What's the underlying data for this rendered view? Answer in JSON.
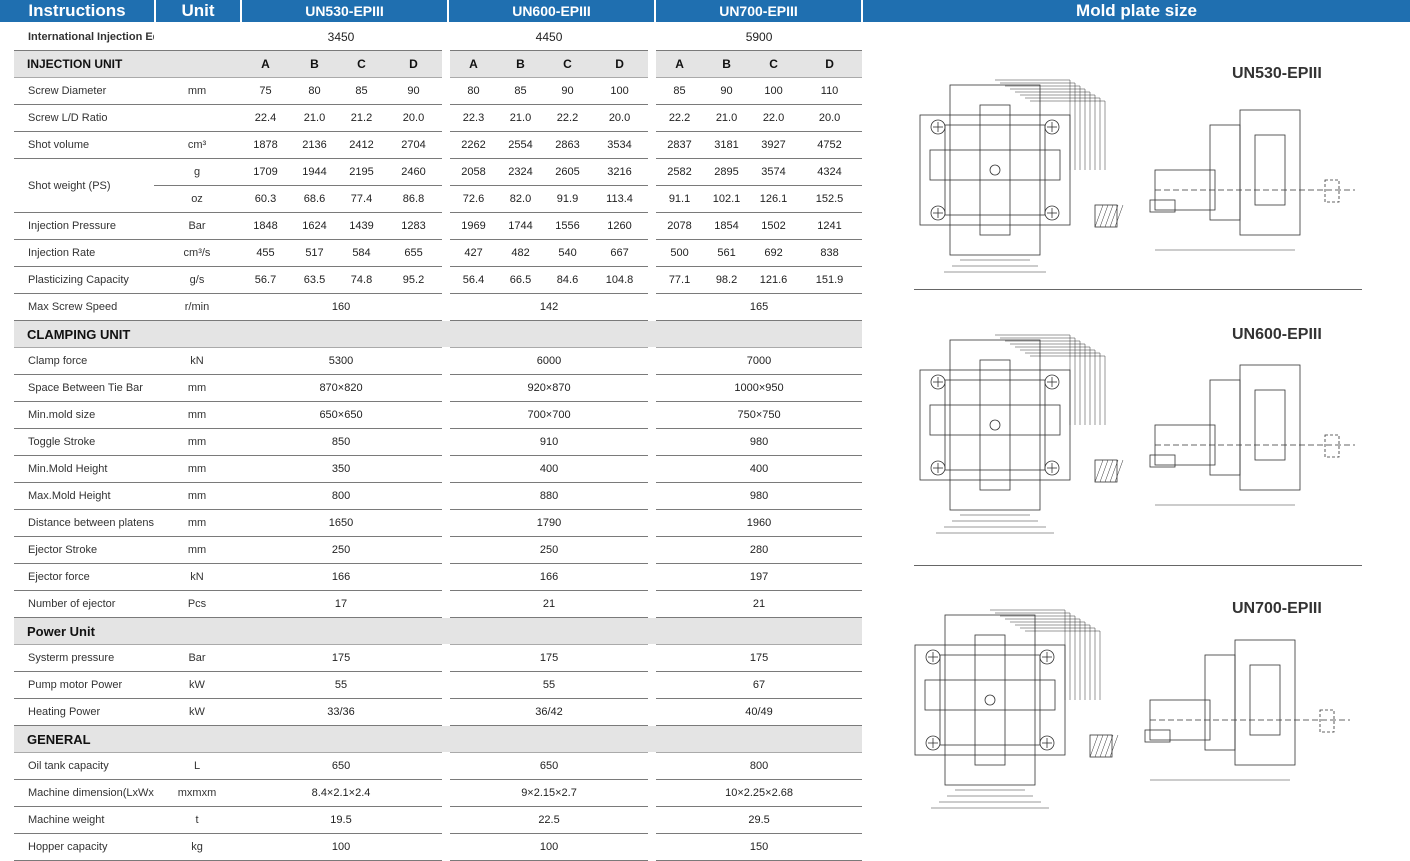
{
  "header": {
    "instructions": "Instructions",
    "unit": "Unit",
    "models": [
      "UN530-EPIII",
      "UN600-EPIII",
      "UN700-EPIII"
    ],
    "mold_plate": "Mold plate size"
  },
  "intl": {
    "label": "International Injection Equivalent",
    "values": [
      "3450",
      "4450",
      "5900"
    ]
  },
  "injection": {
    "title": "INJECTION UNIT",
    "letters": [
      "A",
      "B",
      "C",
      "D"
    ],
    "rows": [
      {
        "label": "Screw Diameter",
        "unit": "mm",
        "values": [
          "75",
          "80",
          "85",
          "90",
          "80",
          "85",
          "90",
          "100",
          "85",
          "90",
          "100",
          "110"
        ]
      },
      {
        "label": "Screw L/D Ratio",
        "unit": "",
        "values": [
          "22.4",
          "21.0",
          "21.2",
          "20.0",
          "22.3",
          "21.0",
          "22.2",
          "20.0",
          "22.2",
          "21.0",
          "22.0",
          "20.0"
        ]
      },
      {
        "label": "Shot volume",
        "unit": "cm³",
        "values": [
          "1878",
          "2136",
          "2412",
          "2704",
          "2262",
          "2554",
          "2863",
          "3534",
          "2837",
          "3181",
          "3927",
          "4752"
        ]
      },
      {
        "label": "Shot weight (PS)",
        "unit": "g",
        "values": [
          "1709",
          "1944",
          "2195",
          "2460",
          "2058",
          "2324",
          "2605",
          "3216",
          "2582",
          "2895",
          "3574",
          "4324"
        ]
      },
      {
        "label": "",
        "unit": "oz",
        "values": [
          "60.3",
          "68.6",
          "77.4",
          "86.8",
          "72.6",
          "82.0",
          "91.9",
          "113.4",
          "91.1",
          "102.1",
          "126.1",
          "152.5"
        ]
      },
      {
        "label": "Injection Pressure",
        "unit": "Bar",
        "values": [
          "1848",
          "1624",
          "1439",
          "1283",
          "1969",
          "1744",
          "1556",
          "1260",
          "2078",
          "1854",
          "1502",
          "1241"
        ]
      },
      {
        "label": "Injection Rate",
        "unit": "cm³/s",
        "values": [
          "455",
          "517",
          "584",
          "655",
          "427",
          "482",
          "540",
          "667",
          "500",
          "561",
          "692",
          "838"
        ]
      },
      {
        "label": "Plasticizing Capacity",
        "unit": "g/s",
        "values": [
          "56.7",
          "63.5",
          "74.8",
          "95.2",
          "56.4",
          "66.5",
          "84.6",
          "104.8",
          "77.1",
          "98.2",
          "121.6",
          "151.9"
        ]
      }
    ],
    "max_speed": {
      "label": "Max Screw Speed",
      "unit": "r/min",
      "values": [
        "160",
        "142",
        "165"
      ]
    }
  },
  "clamping": {
    "title": "CLAMPING UNIT",
    "rows": [
      {
        "label": "Clamp force",
        "unit": "kN",
        "values": [
          "5300",
          "6000",
          "7000"
        ]
      },
      {
        "label": "Space Between Tie Bar",
        "unit": "mm",
        "values": [
          "870×820",
          "920×870",
          "1000×950"
        ]
      },
      {
        "label": "Min.mold size",
        "unit": "mm",
        "values": [
          "650×650",
          "700×700",
          "750×750"
        ]
      },
      {
        "label": "Toggle Stroke",
        "unit": "mm",
        "values": [
          "850",
          "910",
          "980"
        ]
      },
      {
        "label": "Min.Mold Height",
        "unit": "mm",
        "values": [
          "350",
          "400",
          "400"
        ]
      },
      {
        "label": "Max.Mold Height",
        "unit": "mm",
        "values": [
          "800",
          "880",
          "980"
        ]
      },
      {
        "label": "Distance between platens(daylight)",
        "unit": "mm",
        "values": [
          "1650",
          "1790",
          "1960"
        ]
      },
      {
        "label": "Ejector Stroke",
        "unit": "mm",
        "values": [
          "250",
          "250",
          "280"
        ]
      },
      {
        "label": "Ejector force",
        "unit": "kN",
        "values": [
          "166",
          "166",
          "197"
        ]
      },
      {
        "label": "Number of ejector",
        "unit": "Pcs",
        "values": [
          "17",
          "21",
          "21"
        ]
      }
    ]
  },
  "power": {
    "title": "Power  Unit",
    "rows": [
      {
        "label": "Systerm pressure",
        "unit": "Bar",
        "values": [
          "175",
          "175",
          "175"
        ]
      },
      {
        "label": "Pump motor Power",
        "unit": "kW",
        "values": [
          "55",
          "55",
          "67"
        ]
      },
      {
        "label": "Heating Power",
        "unit": "kW",
        "values": [
          "33/36",
          "36/42",
          "40/49"
        ]
      }
    ]
  },
  "general": {
    "title": "GENERAL",
    "rows": [
      {
        "label": "Oil tank capacity",
        "unit": "L",
        "values": [
          "650",
          "650",
          "800"
        ]
      },
      {
        "label": "Machine dimension(LxWxH)",
        "unit": "mxmxm",
        "values": [
          "8.4×2.1×2.4",
          "9×2.15×2.7",
          "10×2.25×2.68"
        ]
      },
      {
        "label": "Machine weight",
        "unit": "t",
        "values": [
          "19.5",
          "22.5",
          "29.5"
        ]
      },
      {
        "label": "Hopper capacity",
        "unit": "kg",
        "values": [
          "100",
          "100",
          "150"
        ]
      }
    ]
  },
  "drawings": [
    {
      "model": "UN530-EPIII"
    },
    {
      "model": "UN600-EPIII"
    },
    {
      "model": "UN700-EPIII"
    }
  ]
}
